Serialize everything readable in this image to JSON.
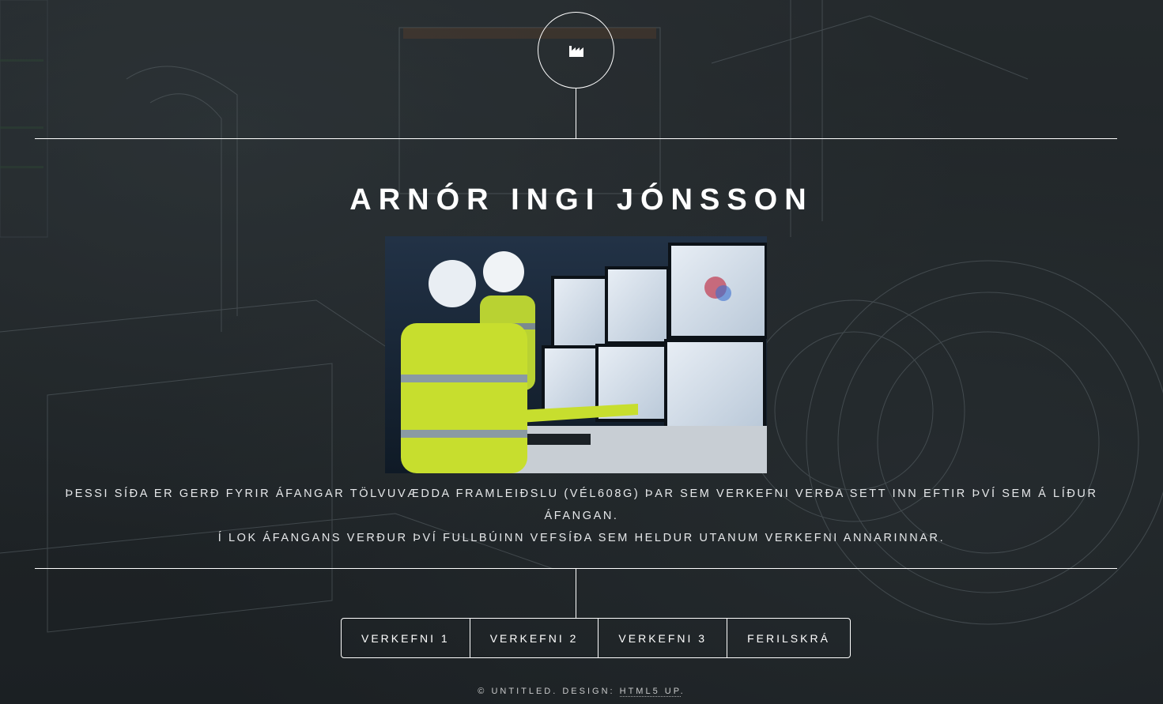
{
  "header": {
    "logo_icon": "factory-icon"
  },
  "main": {
    "title": "ARNÓR INGI JÓNSSON",
    "image_alt": "Engineers at control room monitors",
    "description_line1": "ÞESSI SÍÐA ER GERÐ FYRIR ÁFANGAR TÖLVUVÆDDA FRAMLEIÐSLU (VÉL608G) ÞAR SEM VERKEFNI VERÐA SETT INN EFTIR ÞVÍ SEM Á LÍÐUR ÁFANGAN.",
    "description_line2": "Í LOK ÁFANGANS VERÐUR ÞVÍ FULLBÚINN VEFSÍÐA SEM HELDUR UTANUM VERKEFNI ANNARINNAR."
  },
  "nav": {
    "items": [
      {
        "label": "VERKEFNI 1"
      },
      {
        "label": "VERKEFNI 2"
      },
      {
        "label": "VERKEFNI 3"
      },
      {
        "label": "FERILSKRÁ"
      }
    ]
  },
  "footer": {
    "prefix": "© UNTITLED. DESIGN: ",
    "link": "HTML5 UP",
    "suffix": "."
  },
  "colors": {
    "background": "#1b1f22",
    "foreground": "#ffffff"
  }
}
